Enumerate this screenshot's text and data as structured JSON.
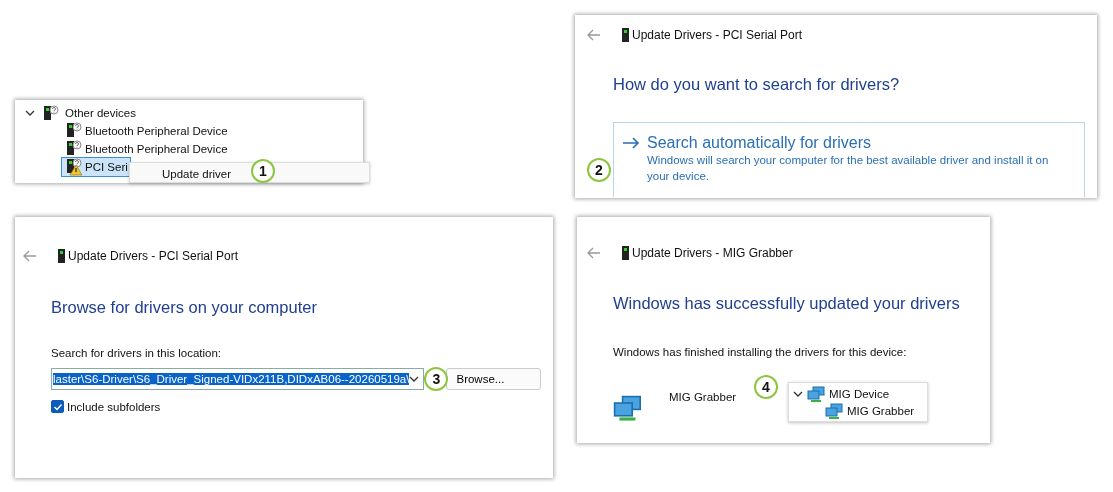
{
  "panels": [
    {
      "kind": "device_tree",
      "tree": {
        "label": "Other devices",
        "expanded": true,
        "children": [
          {
            "label": "Bluetooth Peripheral Device",
            "selected": false,
            "warning": false
          },
          {
            "label": "Bluetooth Peripheral Device",
            "selected": false,
            "warning": false
          },
          {
            "label": "PCI Seri",
            "selected": true,
            "warning": true
          }
        ]
      },
      "context_menu": [
        "Update driver"
      ],
      "step": "1"
    },
    {
      "kind": "search_choice",
      "title": "Update Drivers - PCI Serial Port",
      "heading": "How do you want to search for drivers?",
      "option": {
        "title": "Search automatically for drivers",
        "description": "Windows will search your computer for the best available driver and install it on your device."
      },
      "step": "2"
    },
    {
      "kind": "browse",
      "title": "Update Drivers - PCI Serial Port",
      "heading": "Browse for drivers on your computer",
      "field_label": "Search for drivers in this location:",
      "path": "laster\\S6-Driver\\S6_Driver_Signed-VIDx211B,DIDxAB06--20260519a\\",
      "browse_button": "Browse...",
      "checkbox": {
        "label": "Include subfolders",
        "checked": true
      },
      "step": "3"
    },
    {
      "kind": "success",
      "title": "Update Drivers - MIG Grabber",
      "heading": "Windows has successfully updated your drivers",
      "message": "Windows has finished installing the drivers for this device:",
      "device": "MIG Grabber",
      "tree": {
        "label": "MIG Device",
        "expanded": true,
        "children": [
          {
            "label": "MIG Grabber"
          }
        ]
      },
      "step": "4"
    }
  ]
}
